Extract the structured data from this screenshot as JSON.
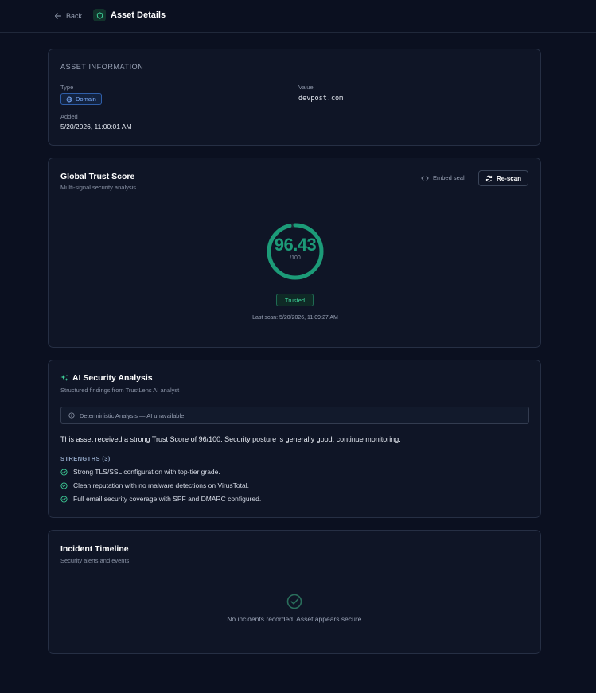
{
  "header": {
    "back_label": "Back",
    "page_title": "Asset Details"
  },
  "asset_info": {
    "section_label": "ASSET INFORMATION",
    "type_label": "Type",
    "type_value": "Domain",
    "value_label": "Value",
    "value": "devpost.com",
    "added_label": "Added",
    "added_value": "5/20/2026, 11:00:01 AM"
  },
  "trust_score": {
    "title": "Global Trust Score",
    "subtitle": "Multi-signal security analysis",
    "embed_label": "Embed seal",
    "rescan_label": "Re-scan",
    "score": "96.43",
    "score_max": "/100",
    "score_fraction": 0.9643,
    "status": "Trusted",
    "last_scan": "Last scan: 5/20/2026, 11:09:27 AM",
    "accent_color": "#1c9b78"
  },
  "ai_analysis": {
    "title": "AI Security Analysis",
    "subtitle": "Structured findings from TrustLens AI analyst",
    "notice": "Deterministic Analysis — AI unavailable",
    "summary": "This asset received a strong Trust Score of 96/100. Security posture is generally good; continue monitoring.",
    "strengths_label": "STRENGTHS (3)",
    "strengths": [
      "Strong TLS/SSL configuration with top-tier grade.",
      "Clean reputation with no malware detections on VirusTotal.",
      "Full email security coverage with SPF and DMARC configured."
    ]
  },
  "incidents": {
    "title": "Incident Timeline",
    "subtitle": "Security alerts and events",
    "empty_message": "No incidents recorded. Asset appears secure."
  }
}
